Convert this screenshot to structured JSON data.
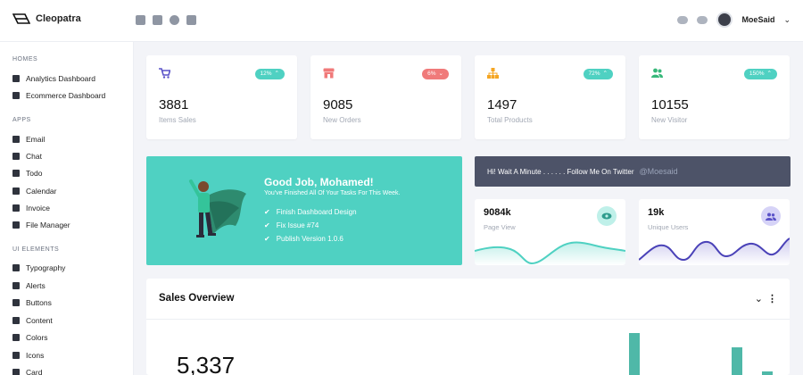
{
  "brand": {
    "name": "Cleopatra"
  },
  "user": {
    "name": "MoeSaid"
  },
  "top_icons": [
    "mail-icon",
    "chat-icon",
    "check-icon",
    "calendar-icon"
  ],
  "sidebar": {
    "sections": [
      {
        "title": "HOMES",
        "items": [
          {
            "label": "Analytics Dashboard",
            "icon": "chart-icon"
          },
          {
            "label": "Ecommerce Dashboard",
            "icon": "shop-icon"
          }
        ]
      },
      {
        "title": "APPS",
        "items": [
          {
            "label": "Email",
            "icon": "envelope-icon"
          },
          {
            "label": "Chat",
            "icon": "comments-icon"
          },
          {
            "label": "Todo",
            "icon": "check-shield-icon"
          },
          {
            "label": "Calendar",
            "icon": "calendar-icon"
          },
          {
            "label": "Invoice",
            "icon": "file-icon"
          },
          {
            "label": "File Manager",
            "icon": "folder-icon"
          }
        ]
      },
      {
        "title": "UI ELEMENTS",
        "items": [
          {
            "label": "Typography",
            "icon": "text-icon"
          },
          {
            "label": "Alerts",
            "icon": "bell-icon"
          },
          {
            "label": "Buttons",
            "icon": "pointer-icon"
          },
          {
            "label": "Content",
            "icon": "layout-icon"
          },
          {
            "label": "Colors",
            "icon": "palette-icon"
          },
          {
            "label": "Icons",
            "icon": "star-icon"
          },
          {
            "label": "Card",
            "icon": "card-icon"
          }
        ]
      }
    ]
  },
  "stats": [
    {
      "value": "3881",
      "label": "Items Sales",
      "percent": "12%",
      "trend": "up",
      "color": "#4fd1c2",
      "icon": "cart-icon"
    },
    {
      "value": "9085",
      "label": "New Orders",
      "percent": "6%",
      "trend": "down",
      "color": "#f07a7a",
      "icon": "store-icon"
    },
    {
      "value": "1497",
      "label": "Total Products",
      "percent": "72%",
      "trend": "up",
      "color": "#4fd1c2",
      "icon": "sitemap-icon"
    },
    {
      "value": "10155",
      "label": "New Visitor",
      "percent": "150%",
      "trend": "up",
      "color": "#4fd1c2",
      "icon": "users-icon"
    }
  ],
  "banner": {
    "title": "Good Job, Mohamed!",
    "subtitle": "You've Finished All Of Your Tasks For This Week.",
    "tasks": [
      "Finish Dashboard Design",
      "Fix Issue #74",
      "Publish Version 1.0.6"
    ],
    "color": "#4fd1c2"
  },
  "twitter": {
    "message": "Hi! Wait A Minute . . . . . . Follow Me On Twitter",
    "handle": "@Moesaid"
  },
  "mini_stats": [
    {
      "value": "9084k",
      "label": "Page View",
      "icon": "eye-icon",
      "color": "#4fd1c2"
    },
    {
      "value": "19k",
      "label": "Unique Users",
      "icon": "users-icon",
      "color": "#5a52c8"
    }
  ],
  "sales": {
    "title": "Sales Overview",
    "value": "5,337"
  }
}
